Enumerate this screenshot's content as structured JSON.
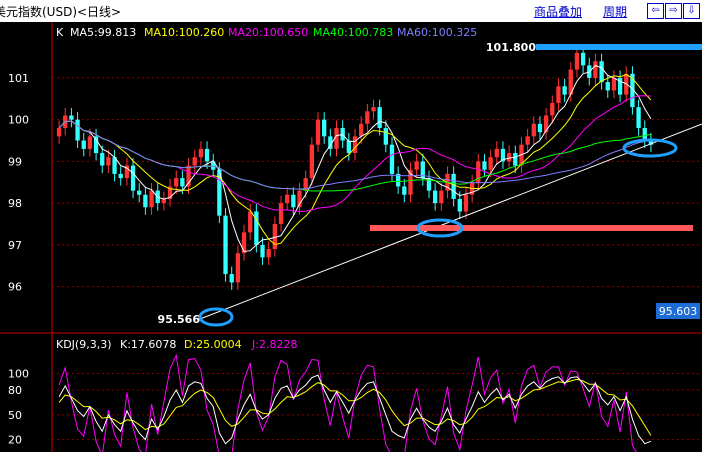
{
  "header": {
    "title": "美元指数(USD)<日线>",
    "link_goods": "商品叠加",
    "link_period": "周期",
    "nav_buttons": [
      "⇦",
      "⇨",
      "⇩"
    ]
  },
  "legend": {
    "k": "K",
    "ma5": "MA5:99.813",
    "ma10": "MA10:100.260",
    "ma20": "MA20:100.650",
    "ma40": "MA40:100.783",
    "ma60": "MA60:100.325"
  },
  "kdj_legend": {
    "name": "KDJ(9,3,3)",
    "k": "K:17.6078",
    "d": "D:25.0004",
    "j": "J:2.8228"
  },
  "annotations": {
    "high": "101.800",
    "low": "95.566",
    "last": "95.603"
  },
  "colors": {
    "background": "#000000",
    "grid": "#8b0000",
    "up": "#ff3333",
    "down": "#33ffff",
    "ma5": "#ffffff",
    "ma10": "#ffff00",
    "ma20": "#ff00ff",
    "ma40": "#00ff00",
    "ma60": "#8080ff",
    "annotation_blue": "#1ea0ff",
    "annotation_red": "#ff5a5a"
  },
  "chart_data": {
    "type": "candlestick",
    "ylim": [
      95.2,
      102.1
    ],
    "yticks": [
      96,
      97,
      98,
      99,
      100,
      101
    ],
    "close": [
      99.8,
      100.1,
      100.0,
      99.5,
      99.3,
      99.6,
      99.2,
      98.9,
      99.1,
      98.7,
      98.6,
      98.9,
      98.3,
      98.2,
      97.9,
      98.3,
      98.0,
      98.1,
      98.4,
      98.6,
      98.4,
      98.9,
      99.1,
      99.3,
      99.0,
      98.8,
      97.7,
      96.3,
      96.1,
      96.8,
      97.3,
      97.8,
      97.0,
      96.7,
      96.9,
      97.5,
      98.0,
      98.2,
      97.9,
      98.3,
      98.6,
      99.4,
      100.0,
      99.6,
      99.3,
      99.8,
      99.5,
      99.2,
      99.6,
      99.9,
      100.2,
      100.3,
      99.8,
      99.4,
      98.7,
      98.4,
      98.2,
      98.8,
      99.0,
      98.6,
      98.3,
      98.0,
      98.3,
      98.7,
      98.1,
      97.8,
      98.2,
      98.5,
      99.0,
      98.8,
      99.1,
      99.3,
      99.0,
      99.2,
      98.9,
      99.4,
      99.6,
      99.9,
      99.7,
      100.1,
      100.4,
      100.8,
      100.6,
      101.2,
      101.6,
      101.3,
      101.0,
      101.4,
      100.9,
      100.7,
      101.0,
      100.6,
      101.1,
      100.3,
      99.8,
      99.5,
      99.4
    ],
    "kdj_yticks": [
      20,
      50,
      80,
      100
    ],
    "kdj_ylim": [
      5,
      120
    ],
    "kdj_k": [
      72,
      85,
      70,
      55,
      48,
      60,
      42,
      30,
      50,
      38,
      30,
      55,
      40,
      28,
      20,
      45,
      32,
      48,
      68,
      80,
      65,
      85,
      90,
      88,
      70,
      60,
      28,
      15,
      22,
      45,
      62,
      75,
      55,
      45,
      50,
      70,
      82,
      85,
      70,
      80,
      86,
      95,
      98,
      80,
      65,
      78,
      65,
      52,
      68,
      80,
      88,
      90,
      70,
      50,
      30,
      25,
      22,
      45,
      58,
      45,
      35,
      30,
      42,
      58,
      38,
      28,
      45,
      60,
      78,
      65,
      75,
      82,
      68,
      75,
      58,
      75,
      85,
      90,
      82,
      90,
      94,
      96,
      88,
      95,
      96,
      88,
      78,
      88,
      70,
      62,
      72,
      55,
      72,
      45,
      25,
      15,
      18
    ],
    "kdj_d": [
      65,
      74,
      72,
      66,
      60,
      60,
      54,
      46,
      47,
      44,
      39,
      44,
      43,
      38,
      32,
      36,
      35,
      39,
      49,
      59,
      61,
      69,
      76,
      80,
      77,
      71,
      57,
      43,
      36,
      39,
      47,
      56,
      56,
      52,
      51,
      57,
      65,
      72,
      71,
      74,
      78,
      84,
      89,
      86,
      79,
      79,
      74,
      67,
      67,
      71,
      77,
      81,
      77,
      68,
      55,
      45,
      37,
      40,
      46,
      46,
      42,
      38,
      39,
      45,
      43,
      38,
      40,
      47,
      57,
      60,
      65,
      71,
      70,
      72,
      67,
      70,
      75,
      80,
      81,
      84,
      87,
      90,
      89,
      91,
      93,
      91,
      87,
      87,
      81,
      75,
      74,
      68,
      69,
      61,
      49,
      37,
      25
    ],
    "kdj_j": [
      86,
      107,
      66,
      33,
      24,
      60,
      18,
      0,
      56,
      26,
      12,
      77,
      34,
      8,
      0,
      63,
      26,
      66,
      106,
      122,
      73,
      117,
      118,
      104,
      56,
      38,
      0,
      0,
      0,
      57,
      92,
      113,
      53,
      31,
      48,
      96,
      116,
      111,
      68,
      92,
      102,
      117,
      116,
      68,
      37,
      76,
      47,
      22,
      70,
      98,
      110,
      108,
      56,
      14,
      0,
      0,
      0,
      55,
      82,
      43,
      21,
      14,
      48,
      84,
      28,
      8,
      55,
      86,
      120,
      75,
      95,
      104,
      64,
      81,
      40,
      85,
      105,
      110,
      84,
      102,
      108,
      108,
      86,
      103,
      102,
      82,
      60,
      90,
      48,
      36,
      68,
      29,
      78,
      13,
      0,
      0,
      4
    ]
  }
}
